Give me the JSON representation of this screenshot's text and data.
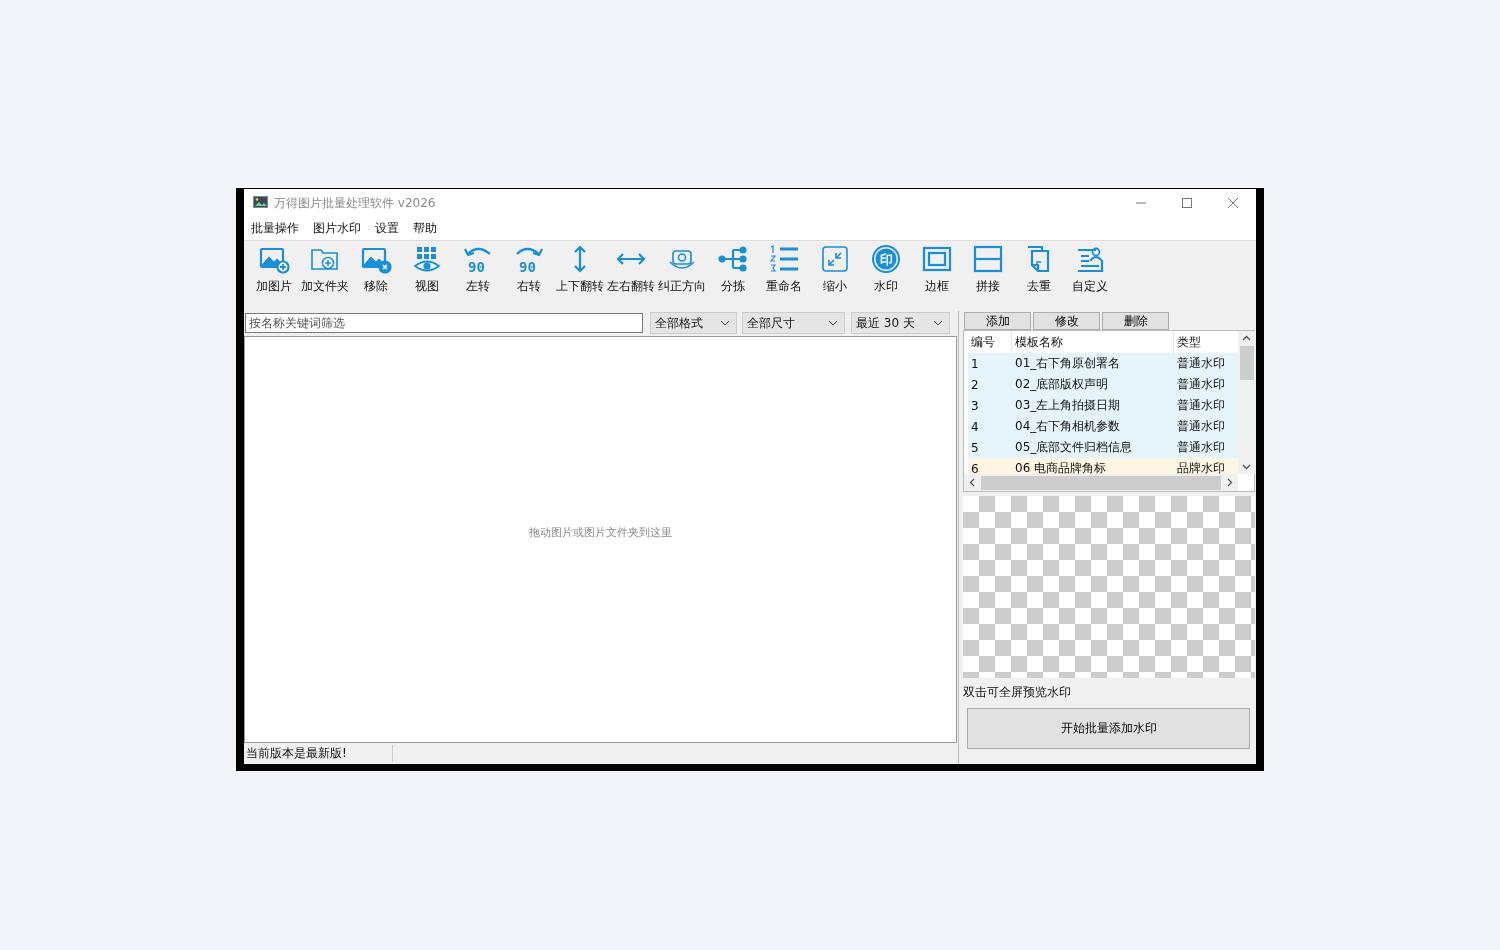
{
  "window": {
    "title": "万得图片批量处理软件 v2026"
  },
  "menu": [
    "批量操作",
    "图片水印",
    "设置",
    "帮助"
  ],
  "toolbar": [
    {
      "label": "加图片"
    },
    {
      "label": "加文件夹"
    },
    {
      "label": "移除"
    },
    {
      "label": "视图"
    },
    {
      "label": "左转"
    },
    {
      "label": "右转"
    },
    {
      "label": "上下翻转"
    },
    {
      "label": "左右翻转"
    },
    {
      "label": "纠正方向"
    },
    {
      "label": "分拣"
    },
    {
      "label": "重命名"
    },
    {
      "label": "缩小"
    },
    {
      "label": "水印"
    },
    {
      "label": "边框"
    },
    {
      "label": "拼接"
    },
    {
      "label": "去重"
    },
    {
      "label": "自定义"
    }
  ],
  "toolbar_icon_text": [
    "90",
    "90",
    "印"
  ],
  "filter": {
    "placeholder": "按名称关键词筛选",
    "dropdowns": [
      "全部格式",
      "全部尺寸",
      "最近 30 天"
    ]
  },
  "drop_hint": "拖动图片或图片文件夹到这里",
  "status_bar": "当前版本是最新版!",
  "template_buttons": [
    "添加",
    "修改",
    "删除"
  ],
  "templates": {
    "columns": [
      "编号",
      "模板名称",
      "类型"
    ],
    "rows": [
      {
        "cells": [
          "1",
          "01_右下角原创署名",
          "普通水印"
        ],
        "color": "#e5f3fb"
      },
      {
        "cells": [
          "2",
          "02_底部版权声明",
          "普通水印"
        ],
        "color": "#e5f3fb"
      },
      {
        "cells": [
          "3",
          "03_左上角拍摄日期",
          "普通水印"
        ],
        "color": "#e5f3fb"
      },
      {
        "cells": [
          "4",
          "04_右下角相机参数",
          "普通水印"
        ],
        "color": "#e5f3fb"
      },
      {
        "cells": [
          "5",
          "05_底部文件归档信息",
          "普通水印"
        ],
        "color": "#e5f3fb"
      },
      {
        "cells": [
          "6",
          "06 电商品牌角标",
          "品牌水印"
        ],
        "color": "#fdf6e3"
      }
    ]
  },
  "preview_hint": "双击可全屏预览水印",
  "start_button": "开始批量添加水印"
}
